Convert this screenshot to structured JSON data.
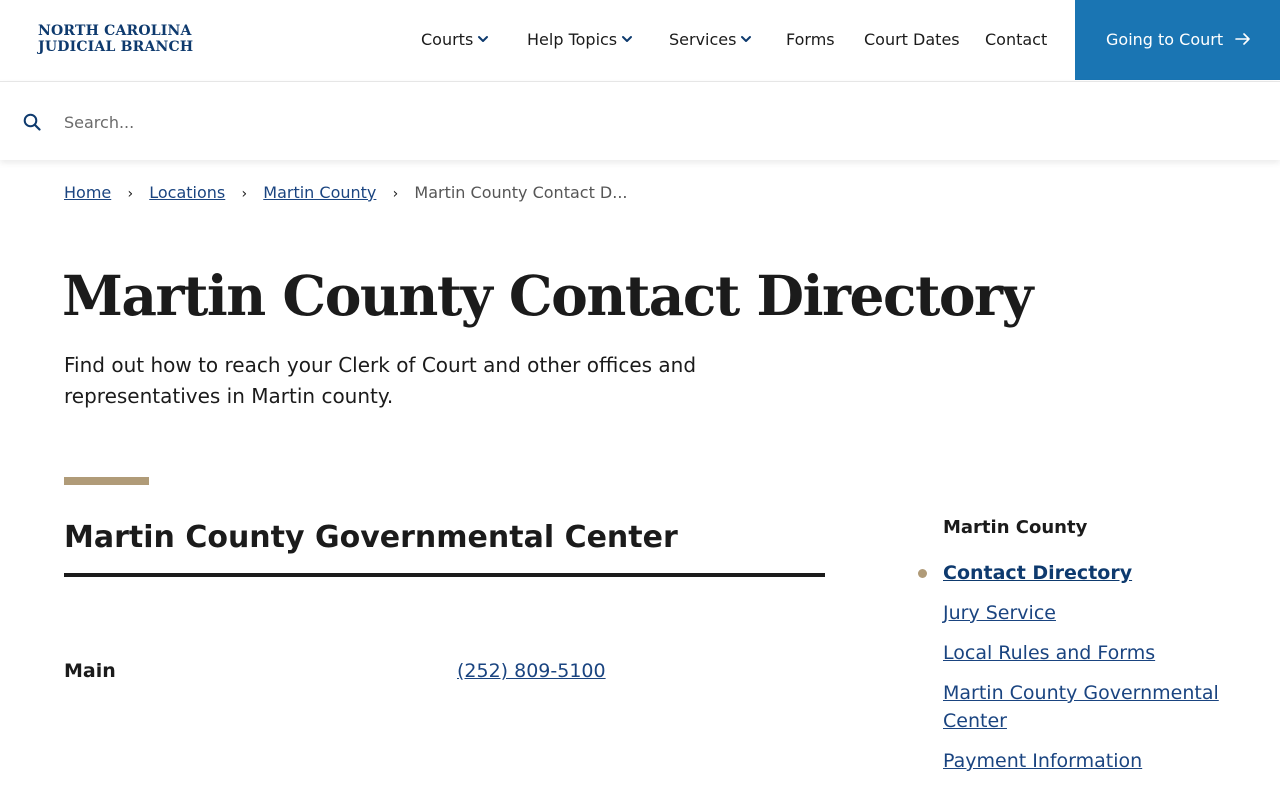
{
  "header": {
    "logo_line1": "NORTH CAROLINA",
    "logo_line2": "JUDICIAL BRANCH",
    "nav": {
      "courts": "Courts",
      "help_topics": "Help Topics",
      "services": "Services",
      "forms": "Forms",
      "court_dates": "Court Dates",
      "contact": "Contact"
    },
    "cta_label": "Going to Court"
  },
  "search": {
    "placeholder": "Search...",
    "value": ""
  },
  "breadcrumb": {
    "home": "Home",
    "locations": "Locations",
    "county": "Martin County",
    "current": "Martin County Contact D..."
  },
  "main": {
    "title": "Martin County Contact Directory",
    "intro": "Find out how to reach your Clerk of Court and other offices and representatives in Martin county.",
    "section_heading": "Martin County Governmental Center",
    "row_label": "Main",
    "row_phone": "(252) 809-5100"
  },
  "sidebar": {
    "title": "Martin County",
    "items": [
      {
        "label": "Contact Directory"
      },
      {
        "label": "Jury Service"
      },
      {
        "label": "Local Rules and Forms"
      },
      {
        "label": "Martin County Governmental Center"
      },
      {
        "label": "Payment Information"
      }
    ]
  },
  "colors": {
    "brand_navy": "#0e3a6e",
    "cta_blue": "#1a75b3",
    "link_blue": "#1a4480",
    "accent_tan": "#b09b78"
  },
  "icons": {
    "search": "search-icon",
    "chevron": "chevron-down-icon",
    "arrow": "arrow-right-icon"
  }
}
